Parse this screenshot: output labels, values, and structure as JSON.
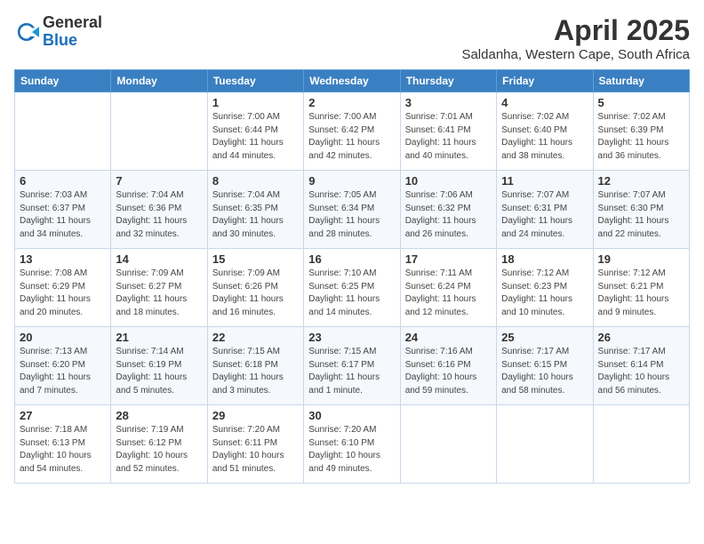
{
  "header": {
    "logo_line1": "General",
    "logo_line2": "Blue",
    "title": "April 2025",
    "location": "Saldanha, Western Cape, South Africa"
  },
  "weekdays": [
    "Sunday",
    "Monday",
    "Tuesday",
    "Wednesday",
    "Thursday",
    "Friday",
    "Saturday"
  ],
  "weeks": [
    [
      {
        "day": "",
        "details": ""
      },
      {
        "day": "",
        "details": ""
      },
      {
        "day": "1",
        "details": "Sunrise: 7:00 AM\nSunset: 6:44 PM\nDaylight: 11 hours\nand 44 minutes."
      },
      {
        "day": "2",
        "details": "Sunrise: 7:00 AM\nSunset: 6:42 PM\nDaylight: 11 hours\nand 42 minutes."
      },
      {
        "day": "3",
        "details": "Sunrise: 7:01 AM\nSunset: 6:41 PM\nDaylight: 11 hours\nand 40 minutes."
      },
      {
        "day": "4",
        "details": "Sunrise: 7:02 AM\nSunset: 6:40 PM\nDaylight: 11 hours\nand 38 minutes."
      },
      {
        "day": "5",
        "details": "Sunrise: 7:02 AM\nSunset: 6:39 PM\nDaylight: 11 hours\nand 36 minutes."
      }
    ],
    [
      {
        "day": "6",
        "details": "Sunrise: 7:03 AM\nSunset: 6:37 PM\nDaylight: 11 hours\nand 34 minutes."
      },
      {
        "day": "7",
        "details": "Sunrise: 7:04 AM\nSunset: 6:36 PM\nDaylight: 11 hours\nand 32 minutes."
      },
      {
        "day": "8",
        "details": "Sunrise: 7:04 AM\nSunset: 6:35 PM\nDaylight: 11 hours\nand 30 minutes."
      },
      {
        "day": "9",
        "details": "Sunrise: 7:05 AM\nSunset: 6:34 PM\nDaylight: 11 hours\nand 28 minutes."
      },
      {
        "day": "10",
        "details": "Sunrise: 7:06 AM\nSunset: 6:32 PM\nDaylight: 11 hours\nand 26 minutes."
      },
      {
        "day": "11",
        "details": "Sunrise: 7:07 AM\nSunset: 6:31 PM\nDaylight: 11 hours\nand 24 minutes."
      },
      {
        "day": "12",
        "details": "Sunrise: 7:07 AM\nSunset: 6:30 PM\nDaylight: 11 hours\nand 22 minutes."
      }
    ],
    [
      {
        "day": "13",
        "details": "Sunrise: 7:08 AM\nSunset: 6:29 PM\nDaylight: 11 hours\nand 20 minutes."
      },
      {
        "day": "14",
        "details": "Sunrise: 7:09 AM\nSunset: 6:27 PM\nDaylight: 11 hours\nand 18 minutes."
      },
      {
        "day": "15",
        "details": "Sunrise: 7:09 AM\nSunset: 6:26 PM\nDaylight: 11 hours\nand 16 minutes."
      },
      {
        "day": "16",
        "details": "Sunrise: 7:10 AM\nSunset: 6:25 PM\nDaylight: 11 hours\nand 14 minutes."
      },
      {
        "day": "17",
        "details": "Sunrise: 7:11 AM\nSunset: 6:24 PM\nDaylight: 11 hours\nand 12 minutes."
      },
      {
        "day": "18",
        "details": "Sunrise: 7:12 AM\nSunset: 6:23 PM\nDaylight: 11 hours\nand 10 minutes."
      },
      {
        "day": "19",
        "details": "Sunrise: 7:12 AM\nSunset: 6:21 PM\nDaylight: 11 hours\nand 9 minutes."
      }
    ],
    [
      {
        "day": "20",
        "details": "Sunrise: 7:13 AM\nSunset: 6:20 PM\nDaylight: 11 hours\nand 7 minutes."
      },
      {
        "day": "21",
        "details": "Sunrise: 7:14 AM\nSunset: 6:19 PM\nDaylight: 11 hours\nand 5 minutes."
      },
      {
        "day": "22",
        "details": "Sunrise: 7:15 AM\nSunset: 6:18 PM\nDaylight: 11 hours\nand 3 minutes."
      },
      {
        "day": "23",
        "details": "Sunrise: 7:15 AM\nSunset: 6:17 PM\nDaylight: 11 hours\nand 1 minute."
      },
      {
        "day": "24",
        "details": "Sunrise: 7:16 AM\nSunset: 6:16 PM\nDaylight: 10 hours\nand 59 minutes."
      },
      {
        "day": "25",
        "details": "Sunrise: 7:17 AM\nSunset: 6:15 PM\nDaylight: 10 hours\nand 58 minutes."
      },
      {
        "day": "26",
        "details": "Sunrise: 7:17 AM\nSunset: 6:14 PM\nDaylight: 10 hours\nand 56 minutes."
      }
    ],
    [
      {
        "day": "27",
        "details": "Sunrise: 7:18 AM\nSunset: 6:13 PM\nDaylight: 10 hours\nand 54 minutes."
      },
      {
        "day": "28",
        "details": "Sunrise: 7:19 AM\nSunset: 6:12 PM\nDaylight: 10 hours\nand 52 minutes."
      },
      {
        "day": "29",
        "details": "Sunrise: 7:20 AM\nSunset: 6:11 PM\nDaylight: 10 hours\nand 51 minutes."
      },
      {
        "day": "30",
        "details": "Sunrise: 7:20 AM\nSunset: 6:10 PM\nDaylight: 10 hours\nand 49 minutes."
      },
      {
        "day": "",
        "details": ""
      },
      {
        "day": "",
        "details": ""
      },
      {
        "day": "",
        "details": ""
      }
    ]
  ]
}
